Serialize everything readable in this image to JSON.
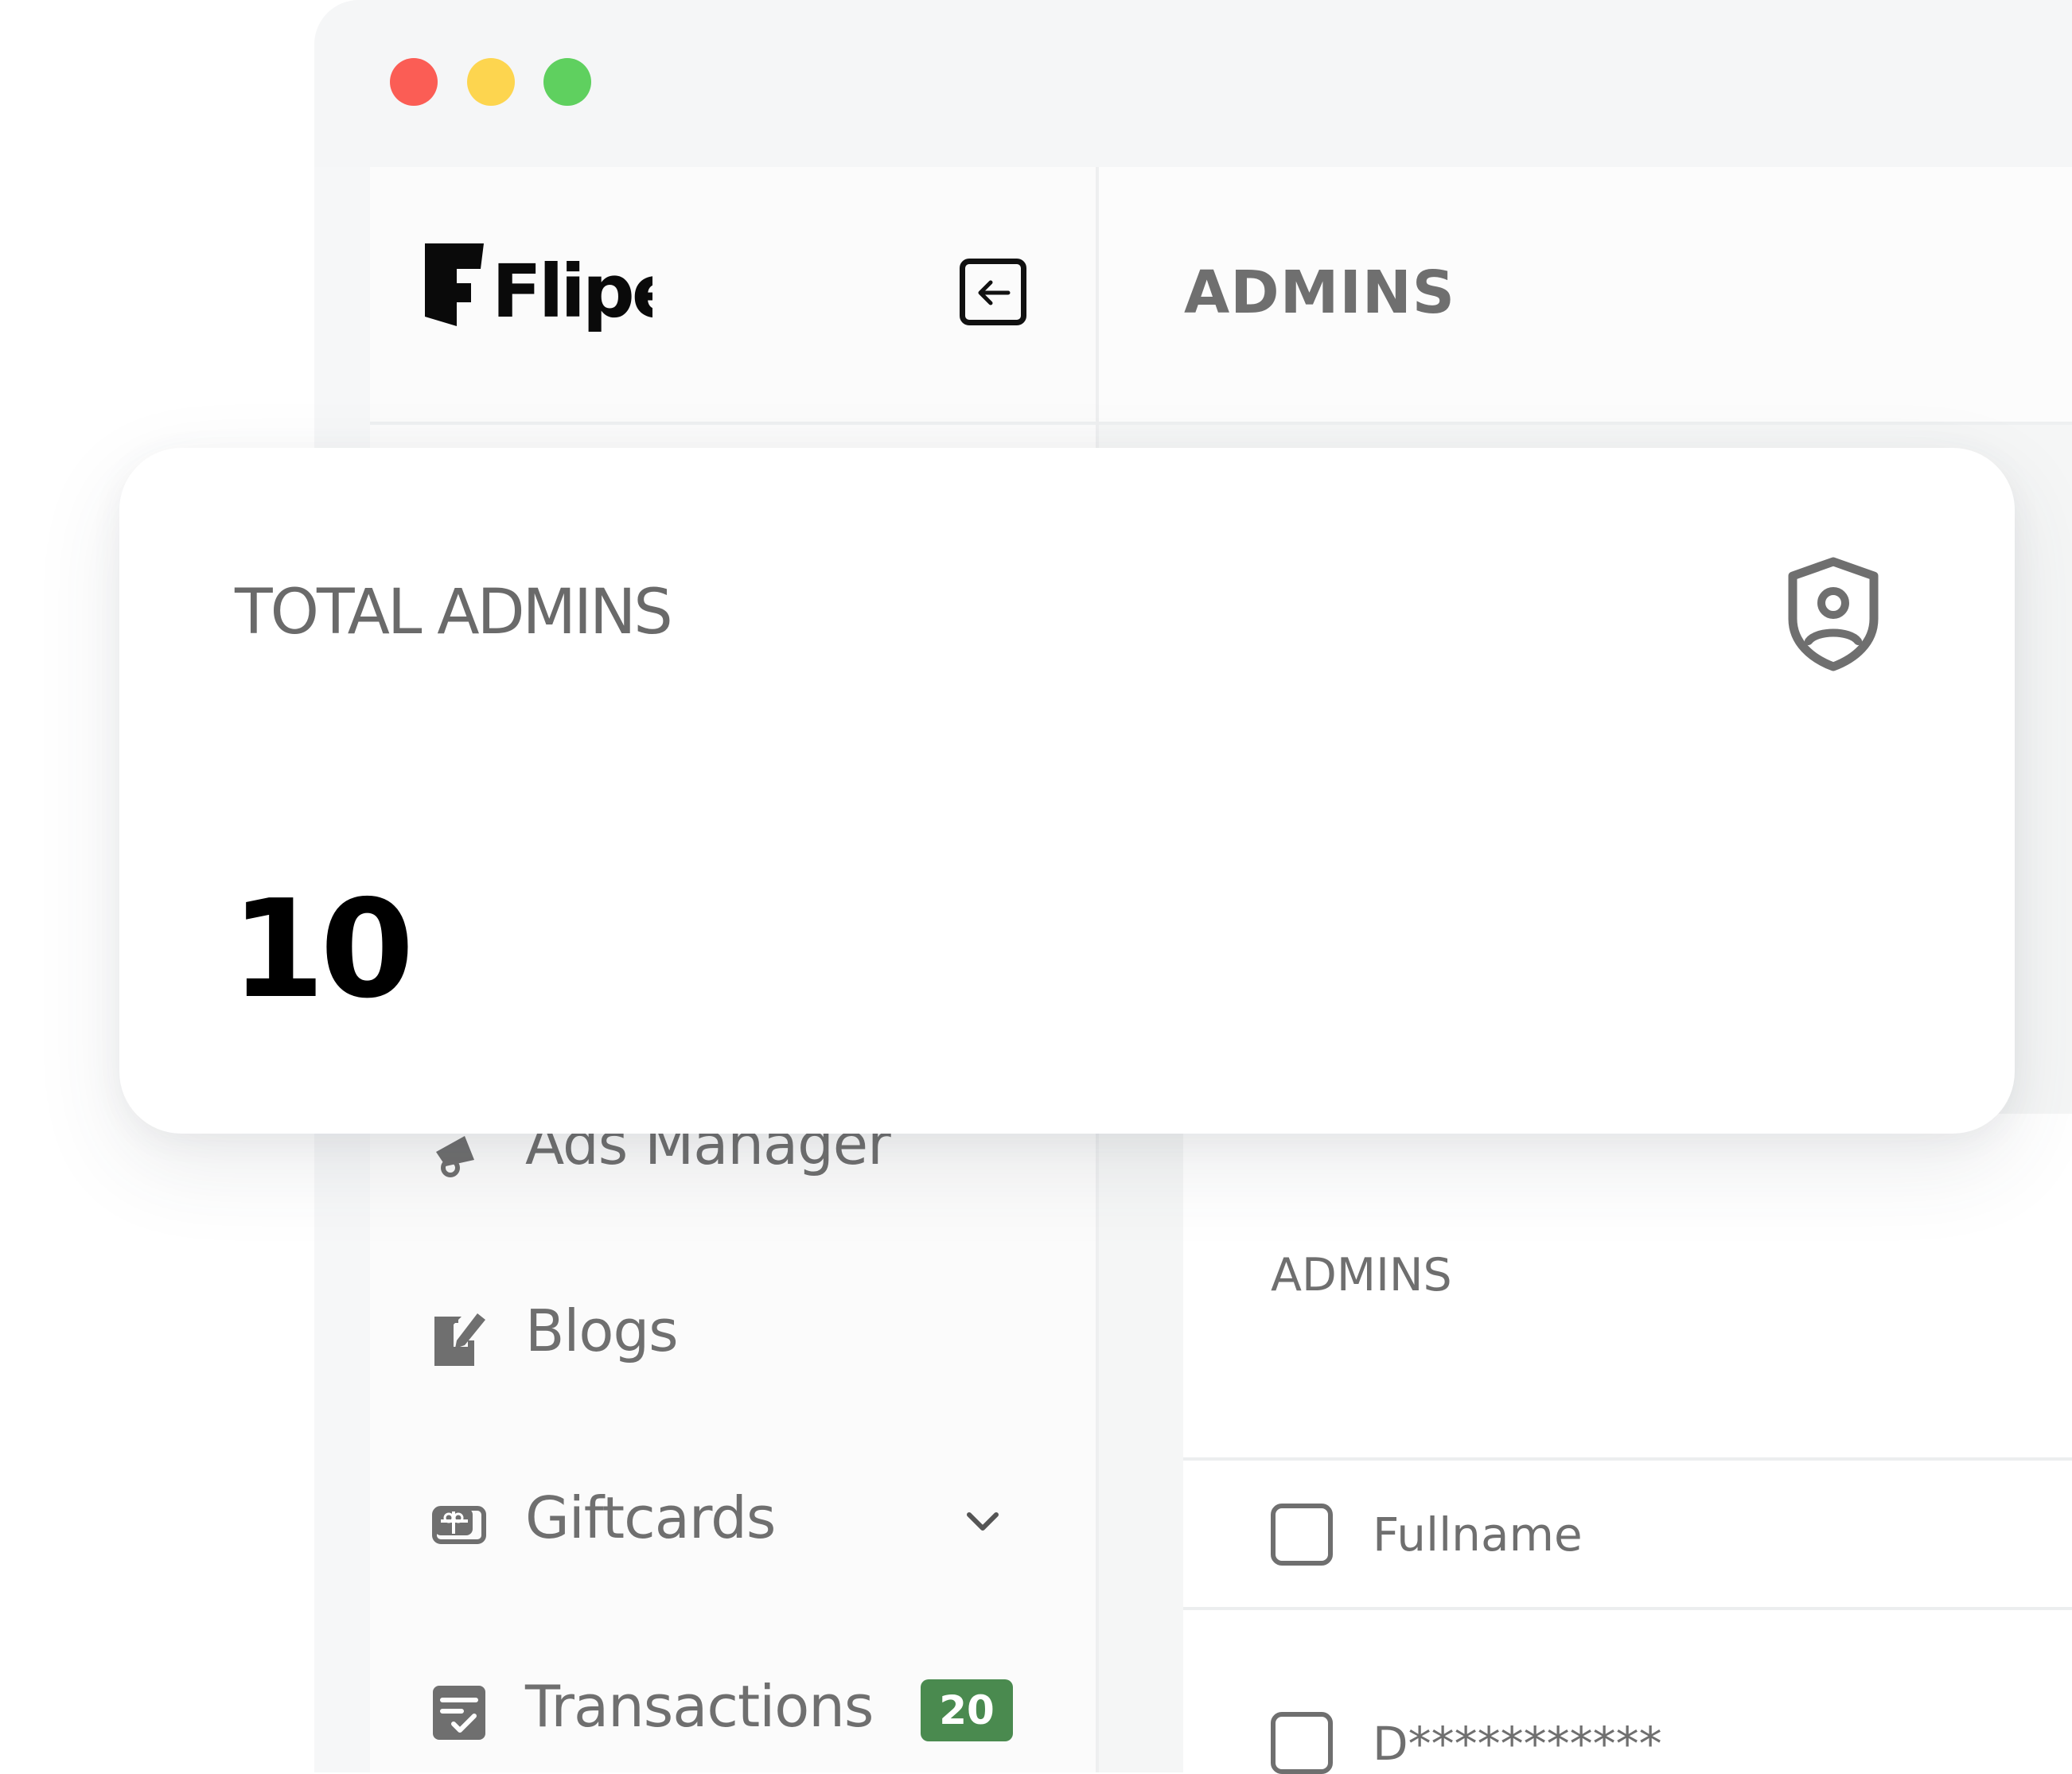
{
  "window": {
    "traffic_lights": [
      {
        "name": "close",
        "color": "#fb5d55"
      },
      {
        "name": "minimize",
        "color": "#fdd54f"
      },
      {
        "name": "maximize",
        "color": "#5fd05f"
      }
    ]
  },
  "sidebar": {
    "logo_text": "Flipex",
    "collapse_icon": "collapse-arrow-icon",
    "items": [
      {
        "label": "Ads Manager",
        "icon": "megaphone-icon"
      },
      {
        "label": "Blogs",
        "icon": "edit-note-icon"
      },
      {
        "label": "Giftcards",
        "icon": "gift-card-icon",
        "expandable": true
      },
      {
        "label": "Transactions",
        "icon": "receipt-check-icon",
        "badge": "20"
      }
    ]
  },
  "header": {
    "title": "ADMINS"
  },
  "stat_card": {
    "label": "TOTAL ADMINS",
    "value": "10",
    "icon": "shield-user-icon"
  },
  "table": {
    "title": "ADMINS",
    "header": {
      "fullname_label": "Fullname"
    },
    "rows": [
      {
        "fullname": "D***********"
      }
    ]
  },
  "colors": {
    "badge": "#4a8a4f",
    "text_muted": "#6f6f6f"
  }
}
